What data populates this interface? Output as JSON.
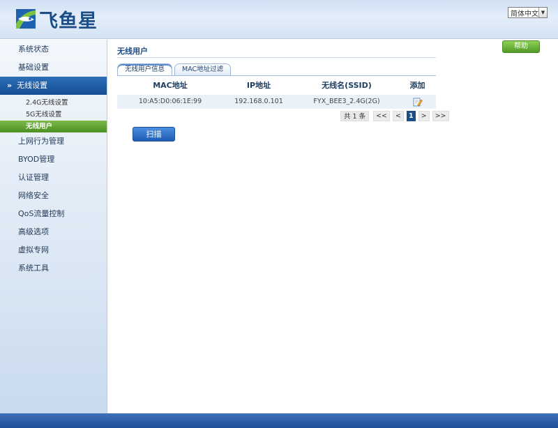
{
  "header": {
    "logo_text": "飞鱼星",
    "language": "简体中文"
  },
  "sidebar": {
    "items": [
      {
        "label": "系统状态"
      },
      {
        "label": "基础设置"
      },
      {
        "label": "无线设置",
        "active": true,
        "children": [
          {
            "label": "2.4G无线设置"
          },
          {
            "label": "5G无线设置"
          },
          {
            "label": "无线用户",
            "active": true
          }
        ]
      },
      {
        "label": "上网行为管理"
      },
      {
        "label": "BYOD管理"
      },
      {
        "label": "认证管理"
      },
      {
        "label": "网络安全"
      },
      {
        "label": "QoS流量控制"
      },
      {
        "label": "高级选项"
      },
      {
        "label": "虚拟专网"
      },
      {
        "label": "系统工具"
      }
    ]
  },
  "main": {
    "title": "无线用户",
    "help_label": "帮助",
    "tabs": [
      {
        "label": "无线用户信息",
        "active": true
      },
      {
        "label": "MAC地址过滤"
      }
    ],
    "table": {
      "headers": [
        "MAC地址",
        "IP地址",
        "无线名(SSID)",
        "添加"
      ],
      "rows": [
        {
          "mac": "10:A5:D0:06:1E:99",
          "ip": "192.168.0.101",
          "ssid": "FYX_BEE3_2.4G(2G)",
          "action_icon": "edit-icon"
        }
      ]
    },
    "pager": {
      "total": "共 1 条",
      "first": "<<",
      "prev": "<",
      "current": "1",
      "next": ">",
      "last": ">>"
    },
    "scan_label": "扫描"
  },
  "colors": {
    "header_bg": "#dbe8f6",
    "nav_active": "#1d5aa5",
    "sub_active": "#5a9a2a",
    "help_button": "#5fae30",
    "scan_button": "#2a6cc4",
    "footer": "#2a58a0"
  }
}
